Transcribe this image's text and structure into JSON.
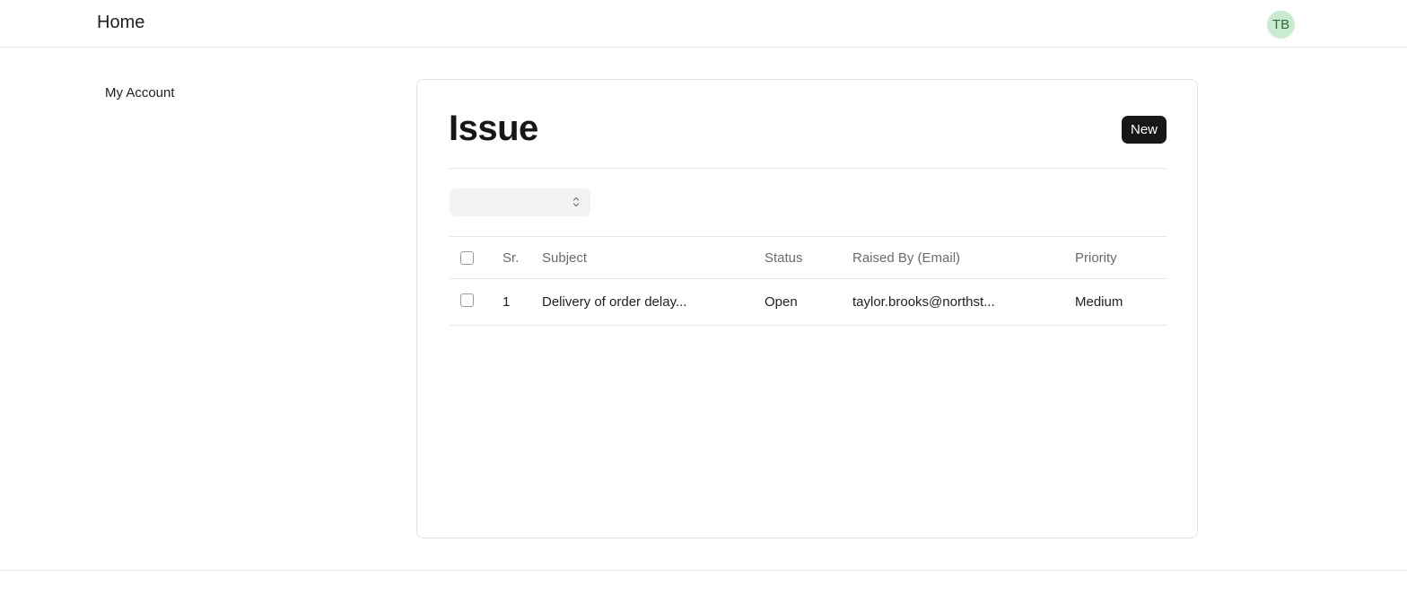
{
  "topbar": {
    "home_label": "Home",
    "avatar_initials": "TB"
  },
  "sidebar": {
    "items": [
      {
        "label": "My Account"
      }
    ]
  },
  "main": {
    "title": "Issue",
    "new_button_label": "New",
    "filter": {
      "selected_value": ""
    },
    "table": {
      "columns": [
        "Sr.",
        "Subject",
        "Status",
        "Raised By (Email)",
        "Priority"
      ],
      "rows": [
        {
          "sr": "1",
          "subject": "Delivery of order delay...",
          "status": "Open",
          "raised_by": "taylor.brooks@northst...",
          "priority": "Medium"
        }
      ]
    }
  }
}
